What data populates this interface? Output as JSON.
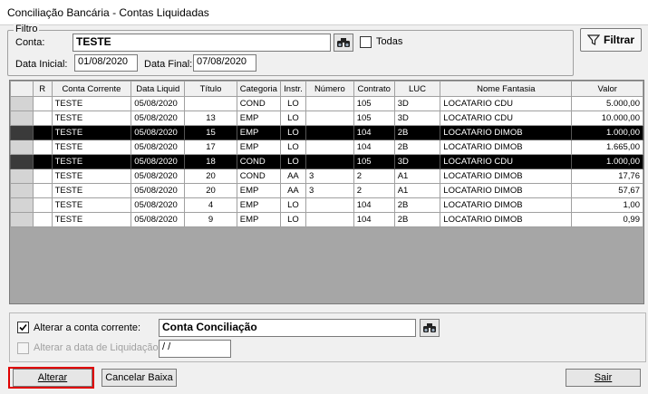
{
  "window": {
    "title": "Conciliação Bancária - Contas Liquidadas"
  },
  "filter": {
    "group_label": "Filtro",
    "conta_label": "Conta:",
    "conta_value": "TESTE",
    "todas_label": "Todas",
    "todas_checked": false,
    "data_inicial_label": "Data Inicial:",
    "data_inicial_value": "01/08/2020",
    "data_final_label": "Data Final:",
    "data_final_value": "07/08/2020",
    "filtrar_label": "Filtrar"
  },
  "grid": {
    "columns": [
      "",
      "R",
      "Conta Corrente",
      "Data Liquid",
      "Título",
      "Categoria",
      "Instr.",
      "Número",
      "Contrato",
      "LUC",
      "Nome Fantasia",
      "Valor"
    ],
    "rows": [
      {
        "selected": false,
        "cells": [
          "",
          "TESTE",
          "05/08/2020",
          "",
          "COND",
          "LO",
          "",
          "105",
          "3D",
          "LOCATARIO CDU",
          "5.000,00"
        ]
      },
      {
        "selected": false,
        "cells": [
          "",
          "TESTE",
          "05/08/2020",
          "13",
          "EMP",
          "LO",
          "",
          "105",
          "3D",
          "LOCATARIO CDU",
          "10.000,00"
        ]
      },
      {
        "selected": true,
        "cells": [
          "",
          "TESTE",
          "05/08/2020",
          "15",
          "EMP",
          "LO",
          "",
          "104",
          "2B",
          "LOCATARIO DIMOB",
          "1.000,00"
        ]
      },
      {
        "selected": false,
        "cells": [
          "",
          "TESTE",
          "05/08/2020",
          "17",
          "EMP",
          "LO",
          "",
          "104",
          "2B",
          "LOCATARIO DIMOB",
          "1.665,00"
        ]
      },
      {
        "selected": true,
        "cells": [
          "",
          "TESTE",
          "05/08/2020",
          "18",
          "COND",
          "LO",
          "",
          "105",
          "3D",
          "LOCATARIO CDU",
          "1.000,00"
        ]
      },
      {
        "selected": false,
        "cells": [
          "",
          "TESTE",
          "05/08/2020",
          "20",
          "COND",
          "AA",
          "3",
          "2",
          "A1",
          "LOCATARIO DIMOB",
          "17,76"
        ]
      },
      {
        "selected": false,
        "cells": [
          "",
          "TESTE",
          "05/08/2020",
          "20",
          "EMP",
          "AA",
          "3",
          "2",
          "A1",
          "LOCATARIO DIMOB",
          "57,67"
        ]
      },
      {
        "selected": false,
        "cells": [
          "",
          "TESTE",
          "05/08/2020",
          "4",
          "EMP",
          "LO",
          "",
          "104",
          "2B",
          "LOCATARIO DIMOB",
          "1,00"
        ]
      },
      {
        "selected": false,
        "cells": [
          "",
          "TESTE",
          "05/08/2020",
          "9",
          "EMP",
          "LO",
          "",
          "104",
          "2B",
          "LOCATARIO DIMOB",
          "0,99"
        ]
      }
    ]
  },
  "bottom": {
    "alterar_conta_label": "Alterar a conta corrente:",
    "alterar_conta_checked": true,
    "conta_conciliacao_value": "Conta Conciliação",
    "alterar_data_label": "Alterar a data de Liquidação:",
    "alterar_data_checked": false,
    "data_liquidacao_value": " /  /"
  },
  "buttons": {
    "alterar": "Alterar",
    "cancelar": "Cancelar Baixa",
    "sair": "Sair"
  },
  "icons": {
    "search": "binoculars-icon",
    "filter": "funnel-icon",
    "check": "checkmark"
  },
  "colors": {
    "selected_row_bg": "#000000",
    "highlight_border": "#e00000",
    "grid_empty_bg": "#a6a6a6"
  }
}
